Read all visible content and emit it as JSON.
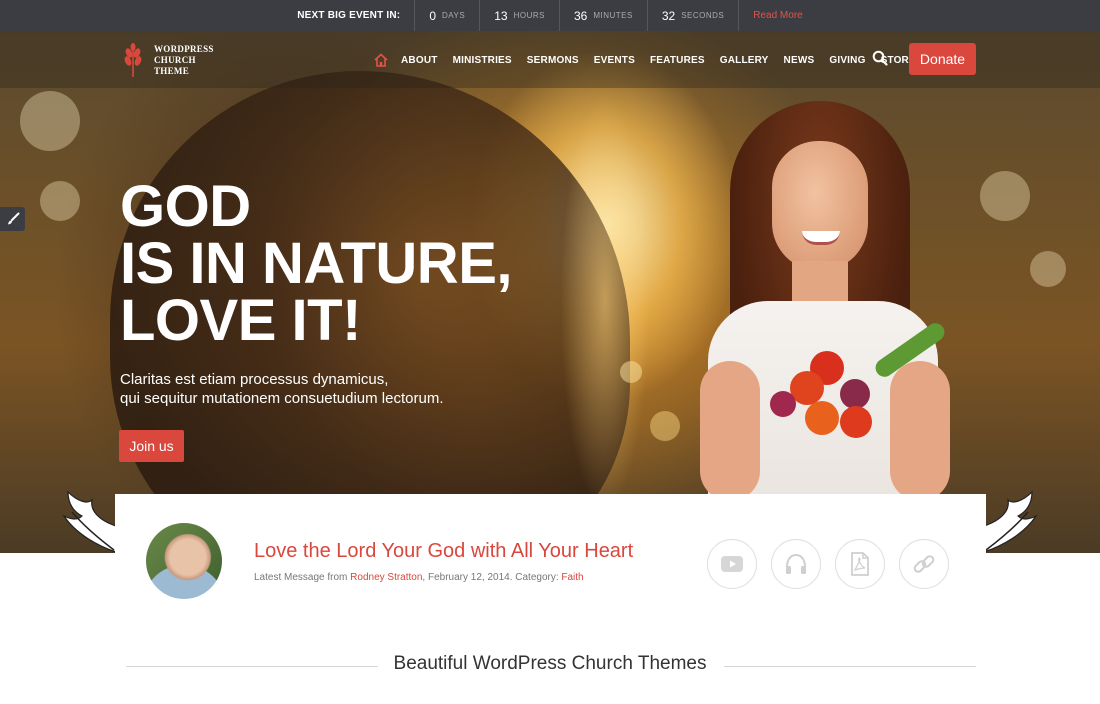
{
  "topbar": {
    "label": "NEXT BIG EVENT IN:",
    "countdown": [
      {
        "value": "0",
        "unit": "DAYS"
      },
      {
        "value": "13",
        "unit": "HOURS"
      },
      {
        "value": "36",
        "unit": "MINUTES"
      },
      {
        "value": "32",
        "unit": "SECONDS"
      }
    ],
    "read_more": "Read More"
  },
  "logo": {
    "line1": "WORDPRESS",
    "line2": "CHURCH",
    "line3": "THEME"
  },
  "nav": {
    "items": [
      "ABOUT",
      "MINISTRIES",
      "SERMONS",
      "EVENTS",
      "FEATURES",
      "GALLERY",
      "NEWS",
      "GIVING",
      "STORE"
    ],
    "donate": "Donate"
  },
  "hero": {
    "title_line1": "GOD",
    "title_line2": "IS IN NATURE,",
    "title_line3": "LOVE IT!",
    "subtitle_line1": "Claritas est etiam processus dynamicus,",
    "subtitle_line2": "qui sequitur mutationem consuetudium lectorum.",
    "cta": "Join us"
  },
  "sermon": {
    "title": "Love the Lord Your God with All Your Heart",
    "meta_prefix": "Latest Message from",
    "author": "Rodney Stratton",
    "date_text": ", February 12, 2014. Category:",
    "category": "Faith",
    "media": [
      "youtube-icon",
      "headphones-icon",
      "pdf-icon",
      "link-icon"
    ]
  },
  "section": {
    "title": "Beautiful WordPress Church Themes"
  },
  "colors": {
    "accent": "#d9473d",
    "topbar_bg": "#3b3d42"
  }
}
